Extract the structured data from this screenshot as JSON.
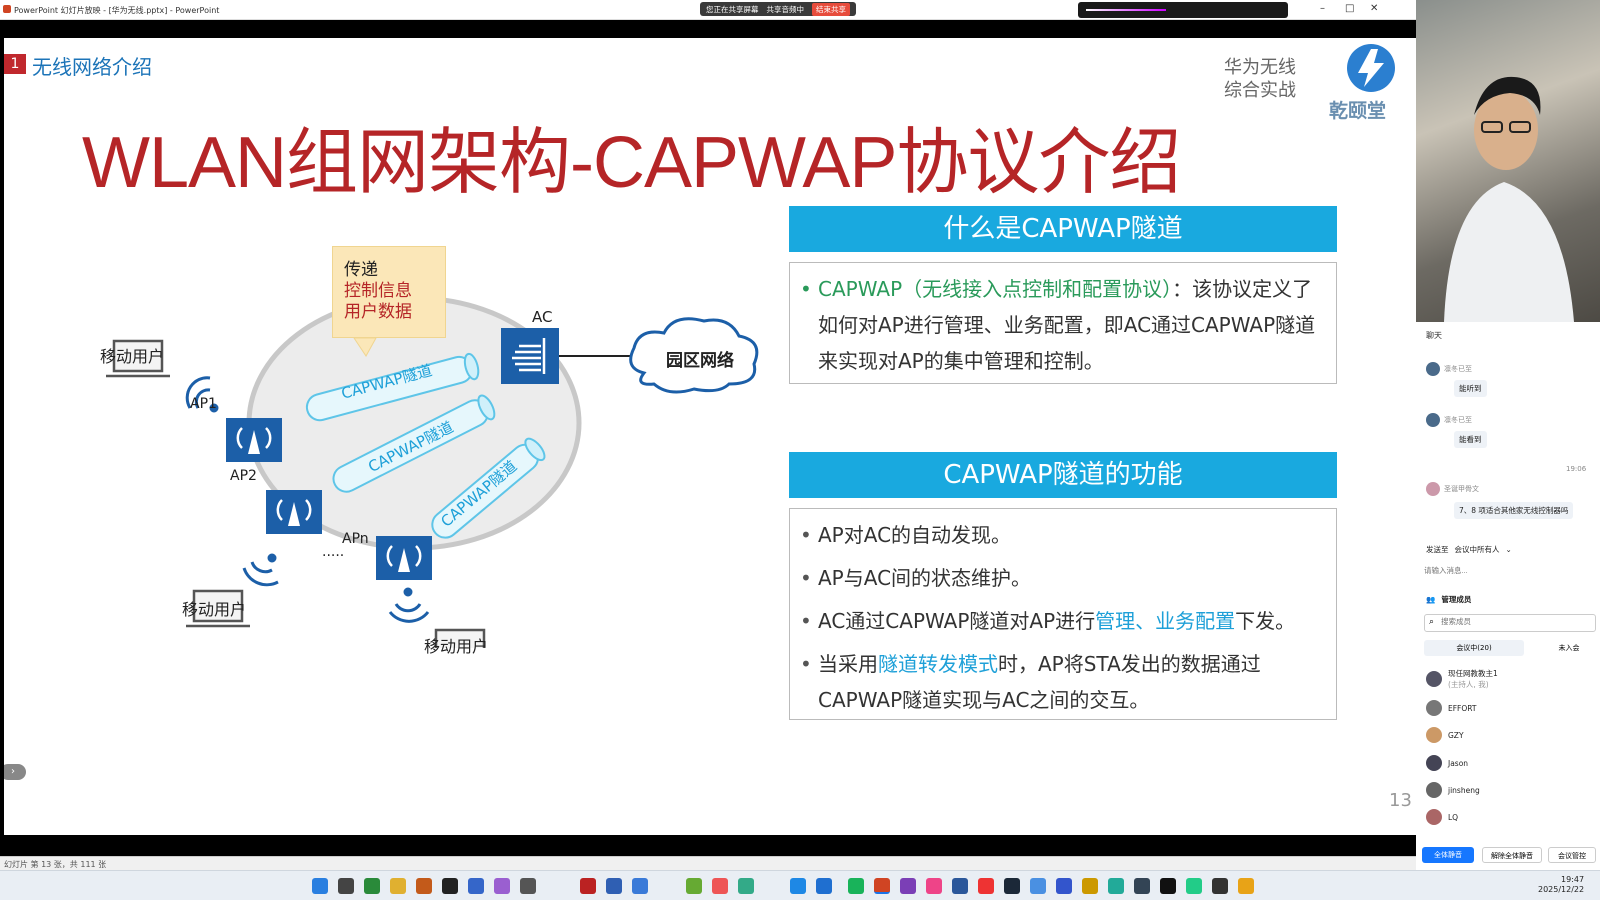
{
  "window": {
    "title": "PowerPoint 幻灯片放映 - [华为无线.pptx] - PowerPoint",
    "share_status": "您正在共享屏幕",
    "share_audio": "共享音频中",
    "stop_share": "结束共享",
    "controls": [
      "–",
      "□",
      "✕"
    ]
  },
  "slide": {
    "section_number": "1",
    "section_title": "无线网络介绍",
    "brand_line1": "华为无线",
    "brand_line2": "综合实战",
    "brand_logo_text": "乾颐堂",
    "title": "WLAN组网架构-CAPWAP协议介绍",
    "page_number": "13",
    "diagram": {
      "callout_line1": "传递",
      "callout_line2": "控制信息",
      "callout_line3": "用户数据",
      "ac_label": "AC",
      "campus_label": "园区网络",
      "ap1": "AP1",
      "ap2": "AP2",
      "apn": "APn",
      "tunnel_label": "CAPWAP隧道",
      "mobile_user": "移动用户"
    },
    "panel1": {
      "header": "什么是CAPWAP隧道",
      "text_green": "CAPWAP（无线接入点控制和配置协议）",
      "text_rest": "：该协议定义了如何对AP进行管理、业务配置，即AC通过CAPWAP隧道来实现对AP的集中管理和控制。"
    },
    "panel2": {
      "header": "CAPWAP隧道的功能",
      "item1": "AP对AC的自动发现。",
      "item2": "AP与AC间的状态维护。",
      "item3_a": "AC通过CAPWAP隧道对AP进行",
      "item3_b": "管理、业务配置",
      "item3_c": "下发。",
      "item4_a": "当采用",
      "item4_b": "隧道转发模式",
      "item4_c": "时，AP将STA发出的数据通过CAPWAP隧道实现与AC之间的交互。"
    }
  },
  "statusbar": {
    "slide_info": "幻灯片 第 13 张，共 111 张"
  },
  "side": {
    "chat_title": "聊天",
    "messages": [
      {
        "sender": "凛冬已至",
        "text": "能听到"
      },
      {
        "sender": "凛冬已至",
        "text": "能看到"
      },
      {
        "time": "19:06"
      },
      {
        "sender": "圣诞甲骨文",
        "text": "7、8 项适合其他家无线控制器吗"
      }
    ],
    "send_to_label": "发送至",
    "send_to_value": "会议中所有人",
    "input_placeholder": "请输入消息...",
    "members_title": "管理成员",
    "search_placeholder": "搜索成员",
    "tab_in": "会议中(20)",
    "tab_out": "未入会",
    "members": [
      {
        "name": "现任网教教主1",
        "role": "(主持人, 我)"
      },
      {
        "name": "EFFORT"
      },
      {
        "name": "GZY"
      },
      {
        "name": "Jason"
      },
      {
        "name": "jinsheng"
      },
      {
        "name": "LQ"
      }
    ],
    "btn_mute_all": "全体静音",
    "btn_unmute_all": "解除全体静音",
    "btn_manage": "会议管控"
  },
  "taskbar": {
    "time": "19:47",
    "date": "2025/12/22"
  },
  "colors": {
    "title_red": "#b52527",
    "header_blue": "#19a9df",
    "green": "#2a9a5a",
    "ap_blue": "#1c5fa8"
  }
}
